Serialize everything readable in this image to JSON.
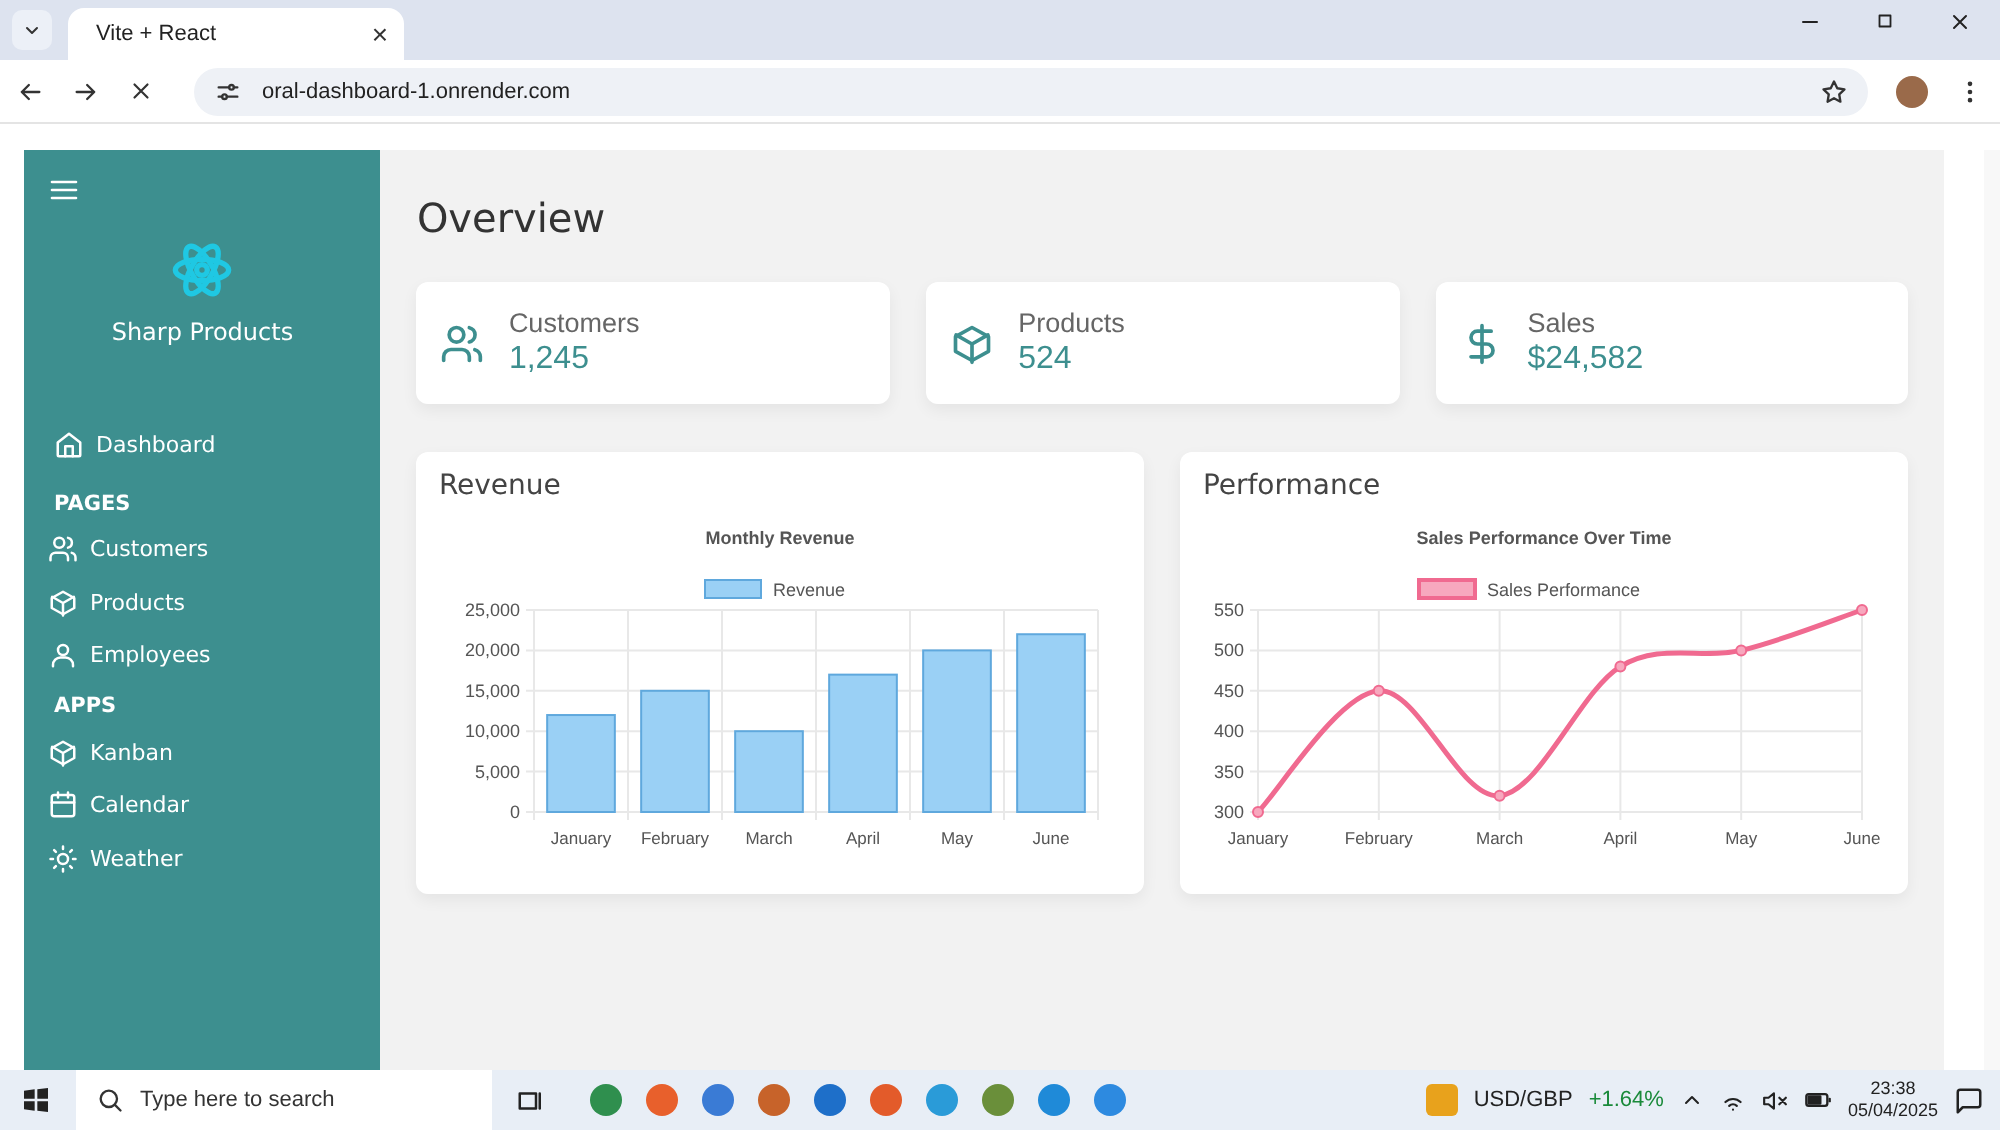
{
  "browser": {
    "tab": {
      "title": "Vite + React",
      "close": "×"
    },
    "address": "oral-dashboard-1.onrender.com"
  },
  "sidebar": {
    "brand": "Sharp Products",
    "items": [
      {
        "kind": "link",
        "label": "Dashboard"
      },
      {
        "kind": "section",
        "label": "PAGES"
      },
      {
        "kind": "link",
        "label": "Customers"
      },
      {
        "kind": "link",
        "label": "Products"
      },
      {
        "kind": "link",
        "label": "Employees"
      },
      {
        "kind": "section",
        "label": "APPS"
      },
      {
        "kind": "link",
        "label": "Kanban"
      },
      {
        "kind": "link",
        "label": "Calendar"
      },
      {
        "kind": "link",
        "label": "Weather"
      }
    ]
  },
  "page_title": "Overview",
  "stats": [
    {
      "label": "Customers",
      "value": "1,245"
    },
    {
      "label": "Products",
      "value": "524"
    },
    {
      "label": "Sales",
      "value": "$24,582"
    }
  ],
  "cards": [
    {
      "title": "Revenue",
      "chart_data": {
        "type": "bar",
        "title": "Monthly Revenue",
        "categories": [
          "January",
          "February",
          "March",
          "April",
          "May",
          "June"
        ],
        "series": [
          {
            "name": "Revenue",
            "color": "#9ad0f5",
            "values": [
              12000,
              15000,
              10000,
              17000,
              20000,
              22000
            ]
          }
        ],
        "ylim": [
          0,
          25000
        ],
        "grid": true,
        "yticks": [
          {
            "value": 0,
            "label": "0"
          },
          {
            "value": 5000,
            "label": "5,000"
          },
          {
            "value": 10000,
            "label": "10,000"
          },
          {
            "value": 15000,
            "label": "15,000"
          },
          {
            "value": 20000,
            "label": "20,000"
          },
          {
            "value": 25000,
            "label": "25,000"
          }
        ]
      }
    },
    {
      "title": "Performance",
      "chart_data": {
        "type": "line",
        "title": "Sales Performance Over Time",
        "categories": [
          "January",
          "February",
          "March",
          "April",
          "May",
          "June"
        ],
        "series": [
          {
            "name": "Sales Performance",
            "color": "#f06a90",
            "marker": true,
            "values": [
              300,
              450,
              320,
              480,
              500,
              550
            ]
          }
        ],
        "ylim": [
          300,
          550
        ],
        "grid": true,
        "yticks": [
          300,
          350,
          400,
          450,
          500,
          550
        ]
      }
    }
  ],
  "taskbar": {
    "search_placeholder": "Type here to search",
    "ticker": "USD/GBP",
    "change": "+1.64%",
    "time": "23:38",
    "date": "05/04/2025"
  }
}
